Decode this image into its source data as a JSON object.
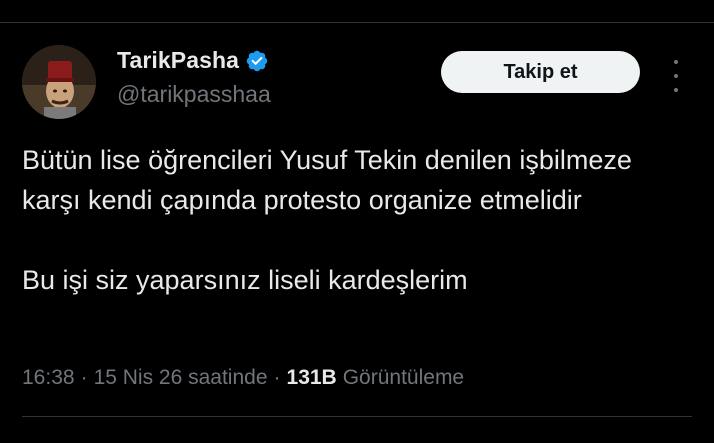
{
  "author": {
    "display_name": "TarikPasha",
    "handle": "@tarikpasshaa",
    "verified": true
  },
  "follow_button": {
    "label": "Takip et"
  },
  "more_menu_icon": "more-vertical-icon",
  "tweet": {
    "paragraphs": [
      "Bütün lise öğrencileri Yusuf Tekin denilen işbilmeze karşı kendi çapında protesto organize etmelidir",
      "Bu işi siz yaparsınız liseli kardeşlerim"
    ],
    "time": "16:38",
    "date": "15 Nis 26 saatinde",
    "separator": "·",
    "views_count": "131B",
    "views_label": "Görüntüleme"
  },
  "colors": {
    "background": "#000000",
    "text_primary": "#e7e9ea",
    "text_secondary": "#71767b",
    "verified_badge": "#1d9bf0",
    "follow_button_bg": "#eff3f4",
    "follow_button_text": "#0f1419",
    "divider": "#2f3336"
  }
}
